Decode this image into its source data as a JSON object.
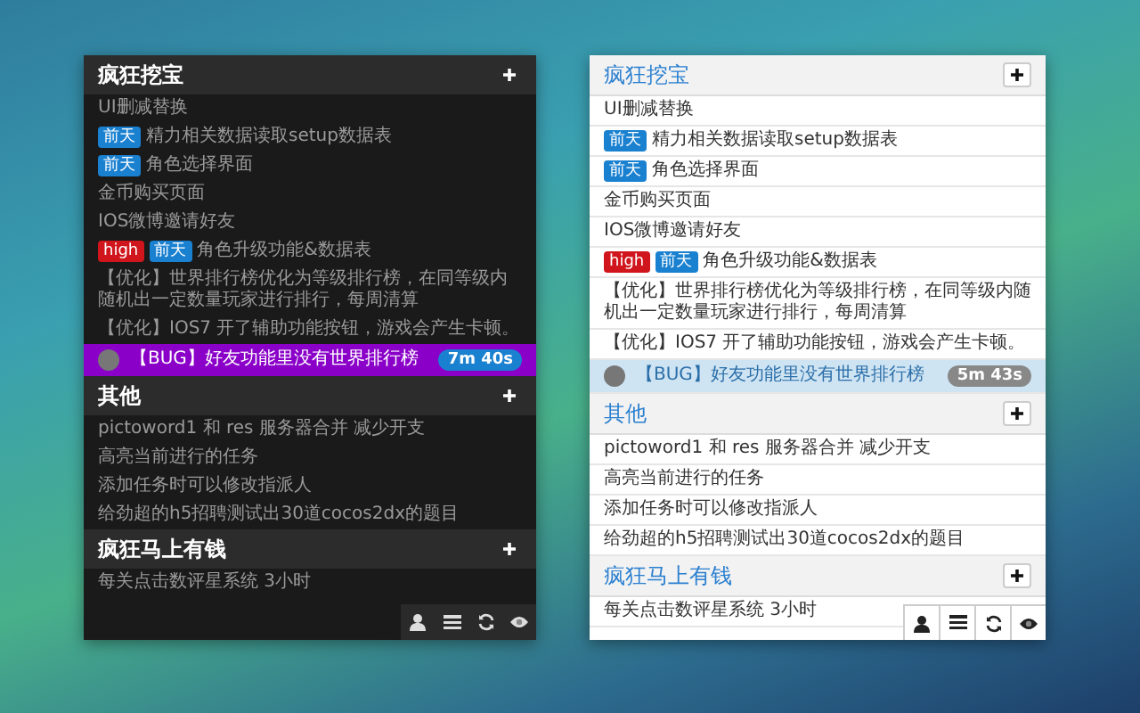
{
  "panels": [
    {
      "kind": "dark",
      "groups": [
        {
          "title": "疯狂挖宝",
          "tasks": [
            {
              "text": "UI删减替换",
              "selected": false
            },
            {
              "text": "精力相关数据读取setup数据表",
              "selected": false,
              "tags": [
                {
                  "label": "前天",
                  "kind": "date"
                }
              ]
            },
            {
              "text": "角色选择界面",
              "selected": false,
              "tags": [
                {
                  "label": "前天",
                  "kind": "date"
                }
              ]
            },
            {
              "text": "金币购买页面",
              "selected": false
            },
            {
              "text": "IOS微博邀请好友",
              "selected": false
            },
            {
              "text": "角色升级功能&数据表",
              "selected": false,
              "tags": [
                {
                  "label": "high",
                  "kind": "priority"
                },
                {
                  "label": "前天",
                  "kind": "date"
                }
              ]
            },
            {
              "text": "【优化】世界排行榜优化为等级排行榜，在同等级内随机出一定数量玩家进行排行，每周清算",
              "selected": false
            },
            {
              "text": "【优化】IOS7 开了辅助功能按钮，游戏会产生卡顿。",
              "selected": false
            },
            {
              "text": "【BUG】好友功能里没有世界排行榜",
              "selected": true,
              "timer": "7m 40s"
            }
          ]
        },
        {
          "title": "其他",
          "tasks": [
            {
              "text": "pictoword1 和 res 服务器合并 减少开支",
              "selected": false
            },
            {
              "text": "高亮当前进行的任务",
              "selected": false
            },
            {
              "text": "添加任务时可以修改指派人",
              "selected": false
            },
            {
              "text": "给劲超的h5招聘测试出30道cocos2dx的题目",
              "selected": false
            }
          ]
        },
        {
          "title": "疯狂马上有钱",
          "tasks": [
            {
              "text": "每关点击数评星系统 3小时",
              "selected": false
            }
          ]
        }
      ]
    },
    {
      "kind": "light",
      "groups": [
        {
          "title": "疯狂挖宝",
          "tasks": [
            {
              "text": "UI删减替换",
              "selected": false
            },
            {
              "text": "精力相关数据读取setup数据表",
              "selected": false,
              "tags": [
                {
                  "label": "前天",
                  "kind": "date"
                }
              ]
            },
            {
              "text": "角色选择界面",
              "selected": false,
              "tags": [
                {
                  "label": "前天",
                  "kind": "date"
                }
              ]
            },
            {
              "text": "金币购买页面",
              "selected": false
            },
            {
              "text": "IOS微博邀请好友",
              "selected": false
            },
            {
              "text": "角色升级功能&数据表",
              "selected": false,
              "tags": [
                {
                  "label": "high",
                  "kind": "priority"
                },
                {
                  "label": "前天",
                  "kind": "date"
                }
              ]
            },
            {
              "text": "【优化】世界排行榜优化为等级排行榜，在同等级内随机出一定数量玩家进行排行，每周清算",
              "selected": false
            },
            {
              "text": "【优化】IOS7 开了辅助功能按钮，游戏会产生卡顿。",
              "selected": false
            },
            {
              "text": "【BUG】好友功能里没有世界排行榜",
              "selected": true,
              "timer": "5m 43s"
            }
          ]
        },
        {
          "title": "其他",
          "tasks": [
            {
              "text": "pictoword1 和 res 服务器合并 减少开支",
              "selected": false
            },
            {
              "text": "高亮当前进行的任务",
              "selected": false
            },
            {
              "text": "添加任务时可以修改指派人",
              "selected": false
            },
            {
              "text": "给劲超的h5招聘测试出30道cocos2dx的题目",
              "selected": false
            }
          ]
        },
        {
          "title": "疯狂马上有钱",
          "tasks": [
            {
              "text": "每关点击数评星系统 3小时",
              "selected": false
            }
          ]
        }
      ]
    }
  ]
}
